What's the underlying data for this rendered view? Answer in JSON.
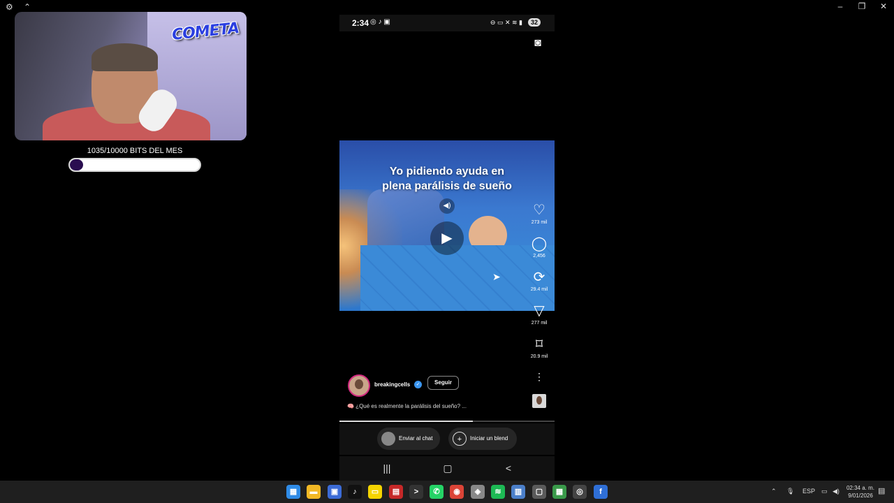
{
  "webcam": {
    "logo_text": "COMETA"
  },
  "bits": {
    "label": "1035/10000 BITS DEL MES",
    "progress": 0.1035
  },
  "phone": {
    "status": {
      "time": "2:34",
      "battery": "32"
    },
    "video": {
      "caption_line1": "Yo pidiendo ayuda en",
      "caption_line2": "plena parálisis de sueño",
      "progress": 0.62
    },
    "actions": [
      {
        "name": "like",
        "icon": "heart-icon",
        "glyph": "♡",
        "count": "273 mil"
      },
      {
        "name": "comment",
        "icon": "comment-icon",
        "glyph": "◯",
        "count": "2,456"
      },
      {
        "name": "repost",
        "icon": "repost-icon",
        "glyph": "⟳",
        "count": "29.4 mil"
      },
      {
        "name": "share",
        "icon": "share-icon",
        "glyph": "▽",
        "count": "277 mil"
      },
      {
        "name": "save",
        "icon": "bookmark-icon",
        "glyph": "⌑",
        "count": "20.9 mil"
      }
    ],
    "author": {
      "username": "breakingcells",
      "follow_label": "Seguir"
    },
    "description": "🧠 ¿Qué es realmente la parálisis del sueño? ...",
    "bottom": {
      "chat_label": "Enviar al chat",
      "blend_label": "Iniciar un blend"
    }
  },
  "taskbar": {
    "apps": [
      {
        "name": "start",
        "glyph": "▦",
        "color": "#2f8be6"
      },
      {
        "name": "file-explorer",
        "glyph": "▬",
        "color": "#f2b824"
      },
      {
        "name": "store",
        "glyph": "▣",
        "color": "#3b6bd6"
      },
      {
        "name": "tiktok",
        "glyph": "♪",
        "color": "#111111"
      },
      {
        "name": "sticky-notes",
        "glyph": "▭",
        "color": "#f5d400"
      },
      {
        "name": "app-red",
        "glyph": "▤",
        "color": "#c62828"
      },
      {
        "name": "terminal",
        "glyph": ">",
        "color": "#333333"
      },
      {
        "name": "whatsapp",
        "glyph": "✆",
        "color": "#25d366"
      },
      {
        "name": "chrome",
        "glyph": "◉",
        "color": "#db4437"
      },
      {
        "name": "shield-app",
        "glyph": "◈",
        "color": "#888888"
      },
      {
        "name": "spotify",
        "glyph": "≋",
        "color": "#1db954"
      },
      {
        "name": "app-blue",
        "glyph": "▥",
        "color": "#4b7fc9"
      },
      {
        "name": "app-window",
        "glyph": "▢",
        "color": "#5a5a5a"
      },
      {
        "name": "app-green",
        "glyph": "▦",
        "color": "#3a9a4a"
      },
      {
        "name": "obs",
        "glyph": "◎",
        "color": "#444444"
      },
      {
        "name": "active-app",
        "glyph": "f",
        "color": "#2f6fd6"
      }
    ],
    "language": "ESP",
    "time": "02:34 a. m.",
    "date": "9/01/2026"
  }
}
